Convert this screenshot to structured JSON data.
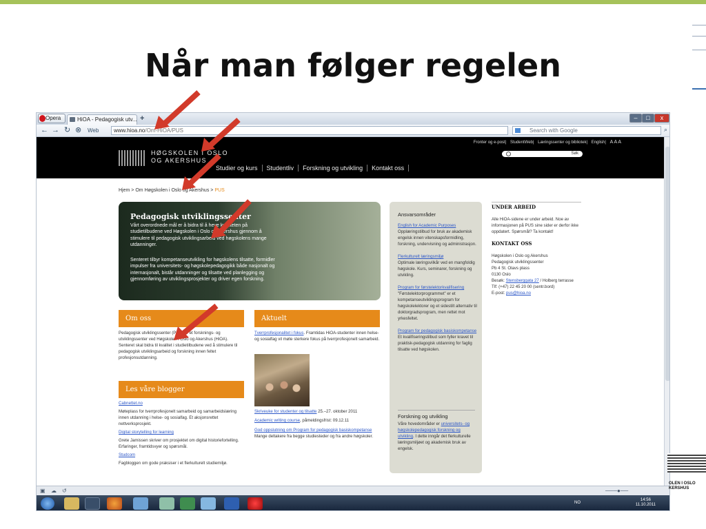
{
  "slide": {
    "title": "Når man følger regelen"
  },
  "browser": {
    "opera_label": "Opera",
    "tab_title": "HiOA - Pedagogisk utv...",
    "new_tab": "+",
    "web_label": "Web",
    "url_host": "www.hioa.no",
    "url_path": "/Om-HiOA/PUS",
    "search_placeholder": "Search with Google",
    "win_buttons": [
      "–",
      "□",
      "x"
    ]
  },
  "site": {
    "logo_line1": "HØGSKOLEN I OSLO",
    "logo_line2": "OG AKERSHUS",
    "top_links": [
      "Fronter og e-post",
      "StudentWeb",
      "Læringssenter og bibliotek",
      "English",
      "A A A"
    ],
    "site_search_button": "Søk",
    "main_nav": [
      "Studier og kurs",
      "Studentliv",
      "Forskning og utvikling",
      "Kontakt oss"
    ],
    "breadcrumb": [
      "Hjem",
      ">",
      "Om Høgskolen i Oslo og Akershus",
      ">",
      "PUS"
    ],
    "hero": {
      "title": "Pedagogisk utviklingssenter",
      "p1": "Vårt overordnede mål er å bidra til å heve kvaliteten på studietilbudene ved Høgskolen i Oslo og Akershus gjennom å stimulere til pedagogisk utviklingsarbeid ved høgskolens mange utdanninger.",
      "p2": "Senteret tilbyr kompetanseutvikling for høgskolens tilsatte, formidler impulser fra universitets- og høgskolepedagogikk både nasjonalt og internasjonalt, bistår utdanninger og tilsatte ved planlegging og gjennomføring av utviklingsprosjekter og driver egen forskning."
    },
    "om_oss": {
      "heading": "Om oss",
      "text": "Pedagogisk utviklingssenter (PUS) er et forsknings- og utviklingssenter ved Høgskolen i Oslo og Akershus (HiOA). Senteret skal bidra til kvalitet i studietilbudene ved å stimulere til pedagogisk utviklingsarbeid og forskning innen feltet profesjonsutdanning."
    },
    "aktuelt": {
      "heading": "Aktuelt",
      "items": [
        {
          "link": "Tverrprofesjonalitet i fokus",
          "text": ". Framtidas HiOA-studenter innen helse-og sosialfag vil møte sterkere fokus på tverrprofesjonelt samarbeid."
        },
        {
          "link": "Skriveuke for studenter og tilsatte",
          "text": " 25.–27. oktober 2011"
        },
        {
          "link": "Academic writing course",
          "text": ", påmeldingsfrist: 09.12.11"
        },
        {
          "link": "God oppslutning om Program for pedagogisk basiskompetanse",
          "text": " Mange deltakere fra begge studiesteder og fra andre høgskoler."
        }
      ]
    },
    "blogger": {
      "heading": "Les våre blogger",
      "items": [
        {
          "link": "Cabnettet.no",
          "text": "Møteplass for tverrprofesjonelt samarbeid og samarbeidslæring innen utdanning i helse- og sosialfag. Et aksjonsrettet nettverksprosjekt."
        },
        {
          "link": "Digital storytelling for learning",
          "text": "Grete Jamissen skriver om prosjektet om digital historiefortelling. Erfaringer, framtidsvyer og spørsmål."
        },
        {
          "link": "Studcom",
          "text": "Fagbloggen om gode praksiser i et flerkulturelt studiemiljø."
        }
      ]
    },
    "ansvar": {
      "heading": "Ansvarsområder",
      "items": [
        {
          "link": "English for Academic Purposes",
          "text": "Opplæringstilbud for bruk av akademisk engelsk innen vitenskapsformidling, forskning, undervisning og administrasjon."
        },
        {
          "link": "Flerkulturelt læringsmiljø",
          "text": "Optimale læringsvilkår ved en mangfoldig høgskole. Kurs, seminarer, forskning og utvikling."
        },
        {
          "link": "Program for førstelektorkvalifisering",
          "text": "\"Førstelektorprogrammet\" er et kompetanseutviklingsprogram for høgskolelektorer og et sidestilt alternativ til doktorgradsprogram, men rettet mot yrkesfeltet."
        },
        {
          "link": "Program for pedagogisk basiskompetanse",
          "text": "Et kvalifiseringstilbud som fyller kravet til praktisk-pedagogisk utdanning for faglig tilsatte ved høgskolen."
        }
      ],
      "fou_heading": "Forskning og utvikling",
      "fou_text_before": "Våre hovedområder er ",
      "fou_link": "universitets- og høgskolepedagogisk forskning og utvikling",
      "fou_text_after": ". I dette inngår det flerkulturelle læringsmiljøet og akademisk bruk av engelsk."
    },
    "under_arbeid": {
      "heading": "UNDER ARBEID",
      "text": "Alle HiOA-sidene er under arbeid. Noe av informasjonen på PUS sine sider er derfor ikke oppdatert. Spørsmål? Ta kontakt!"
    },
    "kontakt": {
      "heading": "KONTAKT OSS",
      "lines": [
        "Høgskolen i Oslo og Akershus",
        "Pedagogisk utviklingssenter",
        "Pb 4 St. Olavs plass",
        "0130 Oslo"
      ],
      "besok_label": "Besøk: ",
      "besok_link": "Stensberggata 27",
      "besok_after": " / Holberg terrasse",
      "phone": "Tlf: (+47) 22 45 20 00 (sentr.bord)",
      "email_label": "E-post: ",
      "email": "pus@hioa.no"
    }
  },
  "taskbar": {
    "lang": "NO",
    "time": "14:56",
    "date": "11.10.2011"
  },
  "corner_logo": {
    "line1": "OLEN I OSLO",
    "line2": "KERSHUS"
  },
  "colors": {
    "accent_bar": "#a6c25a",
    "orange": "#e68a1a",
    "arrow": "#d23a2a",
    "link": "#2b56c7"
  },
  "icons": [
    "opera-icon",
    "back-icon",
    "forward-icon",
    "reload-icon",
    "home-icon",
    "search-icon",
    "windows-start-icon",
    "firefox-icon",
    "word-icon",
    "opera-taskbar-icon",
    "red-arrow-icon"
  ]
}
